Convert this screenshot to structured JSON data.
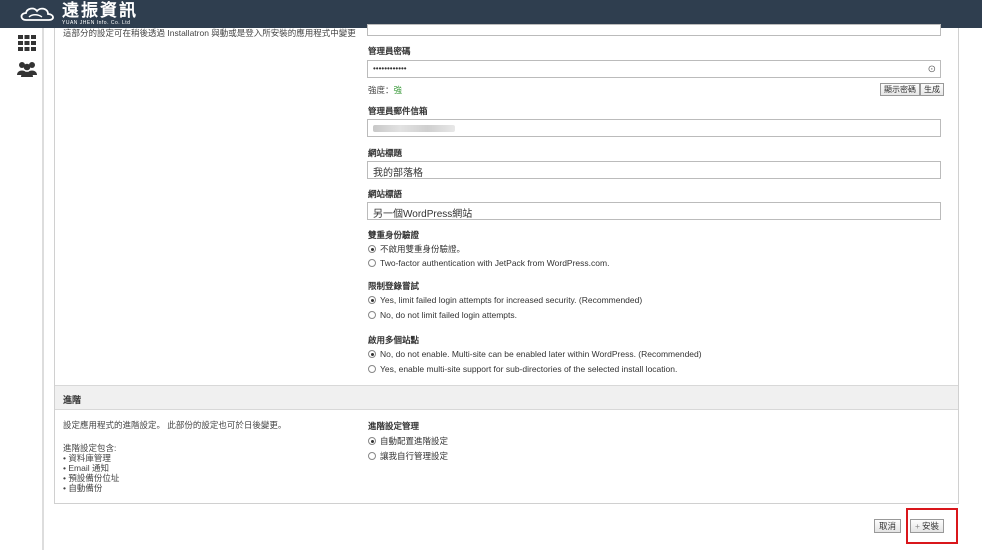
{
  "brand": {
    "name": "遠振資訊",
    "subtitle": "YUAN JHEN Info. Co. Ltd"
  },
  "sidebar": {
    "icons": [
      "apps-grid-icon",
      "users-icon"
    ]
  },
  "settings": {
    "description": "這部分的設定可在稍後透過 Installatron 與動或是登入所安裝的應用程式中變更",
    "admin_password": {
      "label": "管理員密碼",
      "value": "••••••••••••",
      "strength_label": "強度：",
      "strength_value": "強",
      "show_button": "顯示密碼",
      "generate_button": "生成"
    },
    "admin_email": {
      "label": "管理員郵件信箱"
    },
    "site_title": {
      "label": "網站標題",
      "value": "我的部落格"
    },
    "site_tagline": {
      "label": "網站標語",
      "value": "另一個WordPress網站"
    },
    "two_factor": {
      "label": "雙重身份驗證",
      "options": [
        {
          "label": "不啟用雙重身份驗證。",
          "selected": true
        },
        {
          "label": "Two-factor authentication with JetPack from WordPress.com.",
          "selected": false
        }
      ]
    },
    "limit_login": {
      "label": "限制登錄嘗試",
      "options": [
        {
          "label": "Yes, limit failed login attempts for increased security. (Recommended)",
          "selected": true
        },
        {
          "label": "No, do not limit failed login attempts.",
          "selected": false
        }
      ]
    },
    "multisite": {
      "label": "啟用多個站點",
      "options": [
        {
          "label": "No, do not enable. Multi-site can be enabled later within WordPress. (Recommended)",
          "selected": true
        },
        {
          "label": "Yes, enable multi-site support for sub-directories of the selected install location.",
          "selected": false
        }
      ]
    }
  },
  "advanced": {
    "title": "進階",
    "description": "設定應用程式的進階設定。 此部份的設定也可於日後變更。",
    "list_title": "進階設定包含:",
    "list_items": [
      "資料庫管理",
      "Email 通知",
      "預設備份位址",
      "自動備份"
    ],
    "manage": {
      "label": "進階設定管理",
      "options": [
        {
          "label": "自動配置進階設定",
          "selected": true
        },
        {
          "label": "讓我自行管理設定",
          "selected": false
        }
      ]
    }
  },
  "footer": {
    "cancel_label": "取消",
    "install_label": "安裝"
  },
  "colors": {
    "topbar": "#2f3e4f",
    "highlight": "#d9161b",
    "strength": "#3a9a3a"
  }
}
